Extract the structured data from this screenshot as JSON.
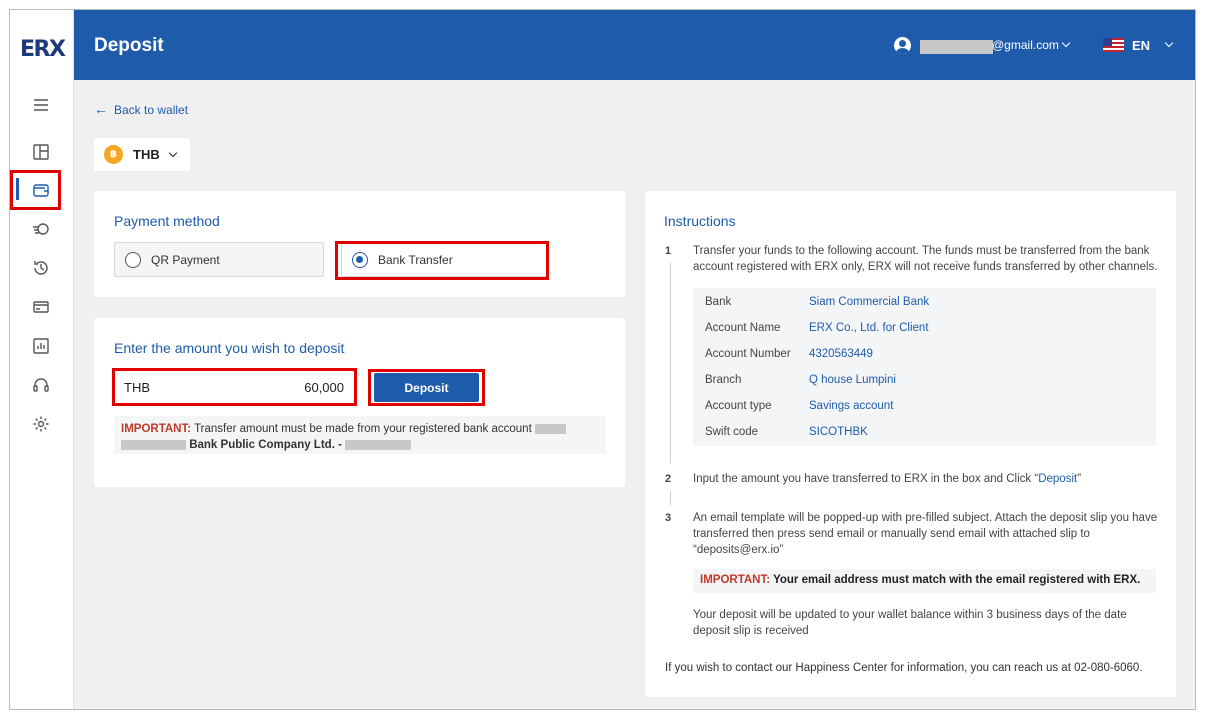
{
  "app": {
    "logo": "ERX",
    "page_title": "Deposit"
  },
  "header": {
    "email_suffix": "@gmail.com",
    "language": "EN"
  },
  "sidebar": {
    "items": [
      {
        "name": "menu-icon"
      },
      {
        "name": "dashboard-icon"
      },
      {
        "name": "wallet-icon",
        "active": true
      },
      {
        "name": "transfer-icon"
      },
      {
        "name": "history-icon"
      },
      {
        "name": "card-icon"
      },
      {
        "name": "report-icon"
      },
      {
        "name": "headset-icon"
      },
      {
        "name": "settings-icon"
      }
    ]
  },
  "nav": {
    "back_label": "Back to wallet"
  },
  "currency": {
    "symbol": "฿",
    "code": "THB"
  },
  "payment_method": {
    "title": "Payment method",
    "options": [
      {
        "label": "QR Payment",
        "selected": false
      },
      {
        "label": "Bank Transfer",
        "selected": true
      }
    ]
  },
  "amount": {
    "title": "Enter the amount you wish to deposit",
    "currency": "THB",
    "value": "60,000",
    "button_label": "Deposit",
    "important_label": "IMPORTANT:",
    "important_text": "Transfer amount must be made from your registered bank account",
    "bank_name": "Bank Public Company Ltd. -"
  },
  "instructions": {
    "title": "Instructions",
    "steps": [
      {
        "num": "1",
        "text": "Transfer your funds to the following account. The funds must be transferred from the bank account registered with ERX only, ERX will not receive funds transferred by other channels."
      },
      {
        "num": "2",
        "text_before": "Input the amount you have transferred to ERX in the box and Click “",
        "link": "Deposit",
        "text_after": "”"
      },
      {
        "num": "3",
        "text": "An email template will be popped-up with pre-filled subject. Attach the deposit slip you have transferred then press send email or manually send email with attached slip to “deposits@erx.io”"
      }
    ],
    "bank_details": [
      {
        "key": "Bank",
        "value": "Siam Commercial Bank"
      },
      {
        "key": "Account Name",
        "value": "ERX Co., Ltd. for Client"
      },
      {
        "key": "Account Number",
        "value": "4320563449"
      },
      {
        "key": "Branch",
        "value": "Q house Lumpini"
      },
      {
        "key": "Account type",
        "value": "Savings account"
      },
      {
        "key": "Swift code",
        "value": "SICOTHBK"
      }
    ],
    "important_label": "IMPORTANT:",
    "important_text": "Your email address must match with the email registered with ERX.",
    "update_note": "Your deposit will be updated to your wallet balance within 3 business days of the date deposit slip is received",
    "contact_note": "If you wish to contact our Happiness Center for information, you can reach us at 02-080-6060."
  },
  "colors": {
    "brand": "#1e5cab",
    "highlight": "#e00000",
    "important": "#c0392b",
    "coin": "#f5a623"
  }
}
